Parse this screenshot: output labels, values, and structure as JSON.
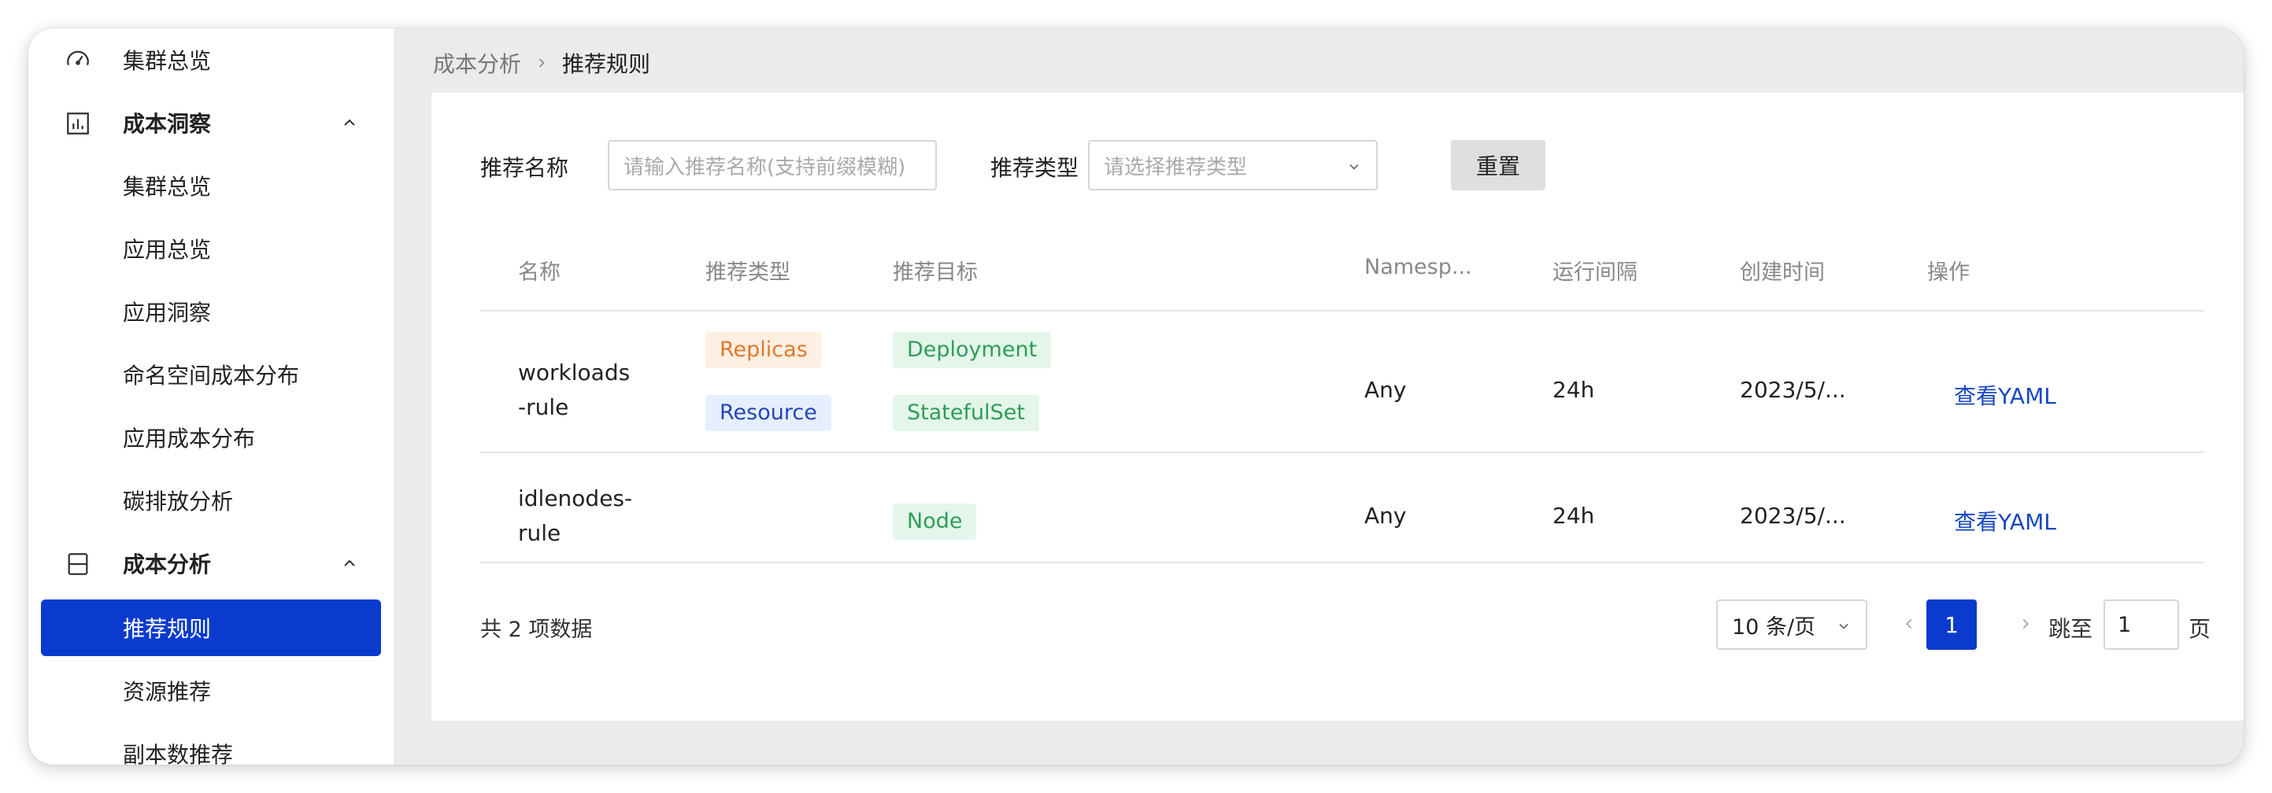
{
  "sidebar": {
    "items": [
      {
        "label": "集群总览",
        "icon": "gauge-icon"
      },
      {
        "label": "成本洞察",
        "icon": "bar-chart-icon"
      },
      {
        "label": "集群总览"
      },
      {
        "label": "应用总览"
      },
      {
        "label": "应用洞察"
      },
      {
        "label": "命名空间成本分布"
      },
      {
        "label": "应用成本分布"
      },
      {
        "label": "碳排放分析"
      },
      {
        "label": "成本分析",
        "icon": "layers-icon"
      },
      {
        "label": "推荐规则"
      },
      {
        "label": "资源推荐"
      },
      {
        "label": "副本数推荐"
      }
    ]
  },
  "breadcrumb": {
    "parent": "成本分析",
    "current": "推荐规则"
  },
  "filters": {
    "name_label": "推荐名称",
    "name_placeholder": "请输入推荐名称(支持前缀模糊)",
    "type_label": "推荐类型",
    "type_placeholder": "请选择推荐类型",
    "reset_label": "重置"
  },
  "table": {
    "columns": [
      "名称",
      "推荐类型",
      "推荐目标",
      "Namesp...",
      "运行间隔",
      "创建时间",
      "操作"
    ],
    "rows": [
      {
        "name_line1": "workloads",
        "name_line2": "-rule",
        "types": [
          "Replicas",
          "Resource"
        ],
        "targets": [
          "Deployment",
          "StatefulSet"
        ],
        "namespace": "Any",
        "interval": "24h",
        "created": "2023/5/...",
        "action": "查看YAML"
      },
      {
        "name_line1": "idlenodes-",
        "name_line2": "rule",
        "types": [],
        "targets": [
          "Node"
        ],
        "namespace": "Any",
        "interval": "24h",
        "created": "2023/5/...",
        "action": "查看YAML"
      }
    ]
  },
  "pagination": {
    "total_text": "共 2 项数据",
    "page_size": "10 条/页",
    "current_page": "1",
    "jump_label": "跳至",
    "jump_value": "1",
    "page_suffix": "页"
  },
  "colors": {
    "primary": "#0a3bce",
    "link": "#1747c2",
    "tag_orange": "#e3782b",
    "tag_blue": "#2446b8",
    "tag_green": "#2e9e57"
  }
}
